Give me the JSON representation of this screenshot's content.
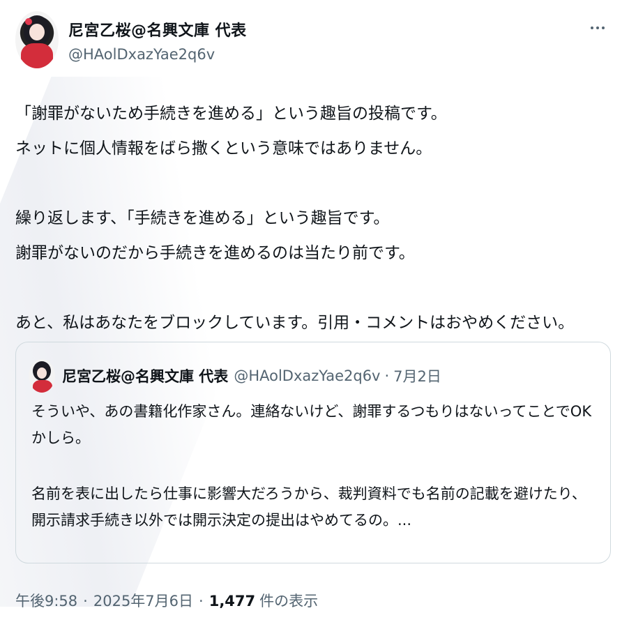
{
  "author": {
    "display_name": "尼宮乙桜@名興文庫 代表",
    "handle": "@HAolDxazYae2q6v"
  },
  "tweet": {
    "lines": [
      "「謝罪がないため手続きを進める」という趣旨の投稿です。",
      "ネットに個人情報をばら撒くという意味ではありません。",
      "",
      "繰り返します、「手続きを進める」という趣旨です。",
      "謝罪がないのだから手続きを進めるのは当たり前です。",
      "",
      "あと、私はあなたをブロックしています。引用・コメントはおやめください。"
    ]
  },
  "quoted": {
    "display_name": "尼宮乙桜@名興文庫 代表",
    "handle": "@HAolDxazYae2q6v",
    "separator": "·",
    "date": "7月2日",
    "lines": [
      "そういや、あの書籍化作家さん。連絡ないけど、謝罪するつもりはないってことでOK",
      "かしら。",
      "",
      "名前を表に出したら仕事に影響大だろうから、裁判資料でも名前の記載を避けたり、",
      "開示請求手続き以外では開示決定の提出はやめてるの。..."
    ]
  },
  "meta": {
    "time": "午後9:58",
    "separator": "·",
    "date": "2025年7月6日",
    "views_count": "1,477",
    "views_label": "件の表示"
  },
  "icons": {
    "more": "more-horizontal-icon"
  },
  "colors": {
    "text": "#0f1419",
    "secondary": "#536471",
    "border": "#cfd9de"
  }
}
